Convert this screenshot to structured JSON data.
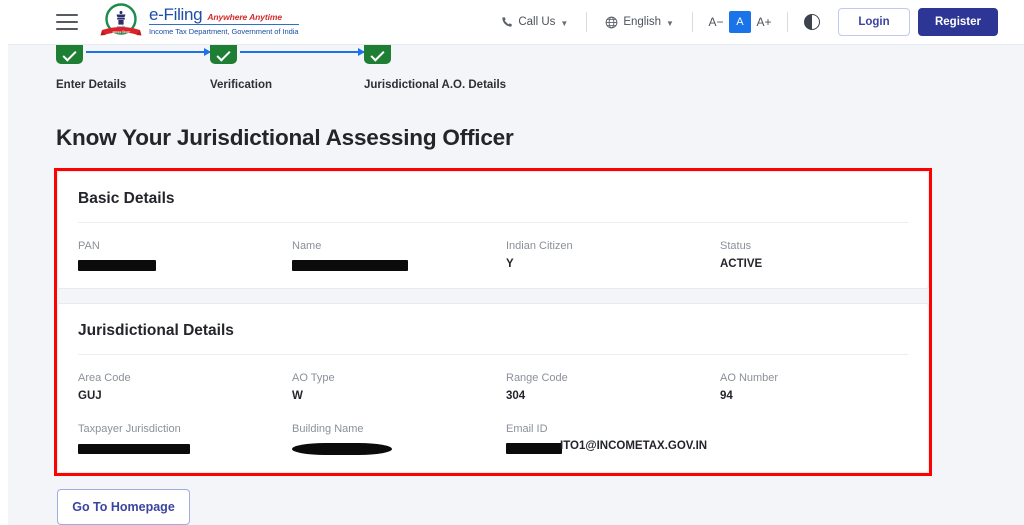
{
  "header": {
    "menu_icon": "hamburger-menu-icon",
    "logo": {
      "emblem_icon": "india-national-emblem",
      "title": "e-Filing",
      "tagline": "Anywhere Anytime",
      "subtitle": "Income Tax Department, Government of India"
    },
    "call_us": {
      "label": "Call Us",
      "icon": "phone-icon"
    },
    "language": {
      "label": "English",
      "icon": "globe-icon"
    },
    "font_controls": {
      "decrease": "A−",
      "normal": "A",
      "increase": "A+",
      "contrast_icon": "contrast-toggle-icon"
    },
    "login_label": "Login",
    "register_label": "Register"
  },
  "stepper": {
    "steps": [
      {
        "label": "Enter Details",
        "state": "completed"
      },
      {
        "label": "Verification",
        "state": "completed"
      },
      {
        "label": "Jurisdictional A.O. Details",
        "state": "completed"
      }
    ]
  },
  "page": {
    "title": "Know Your Jurisdictional Assessing Officer"
  },
  "basic_details": {
    "title": "Basic Details",
    "fields": [
      {
        "label": "PAN",
        "value": "",
        "redacted": true
      },
      {
        "label": "Name",
        "value": "",
        "redacted": true
      },
      {
        "label": "Indian Citizen",
        "value": "Y",
        "redacted": false
      },
      {
        "label": "Status",
        "value": "ACTIVE",
        "redacted": false
      }
    ]
  },
  "jurisdictional_details": {
    "title": "Jurisdictional Details",
    "row1": [
      {
        "label": "Area Code",
        "value": "GUJ",
        "redacted": false
      },
      {
        "label": "AO Type",
        "value": "W",
        "redacted": false
      },
      {
        "label": "Range Code",
        "value": "304",
        "redacted": false
      },
      {
        "label": "AO Number",
        "value": "94",
        "redacted": false
      }
    ],
    "row2": [
      {
        "label": "Taxpayer Jurisdiction",
        "value": "",
        "redacted": true
      },
      {
        "label": "Building Name",
        "value": "",
        "redacted": true
      },
      {
        "label": "Email ID",
        "value": "ITO1@INCOMETAX.GOV.IN",
        "redacted": true
      }
    ]
  },
  "footer": {
    "homepage_label": "Go To Homepage"
  },
  "colors": {
    "brand_blue": "#1d4ea8",
    "register_bg": "#2d3694",
    "step_green": "#1e7e34",
    "connector_blue": "#1a73e8",
    "annotation_red": "#ff0000",
    "page_bg": "#f4f5f9"
  }
}
